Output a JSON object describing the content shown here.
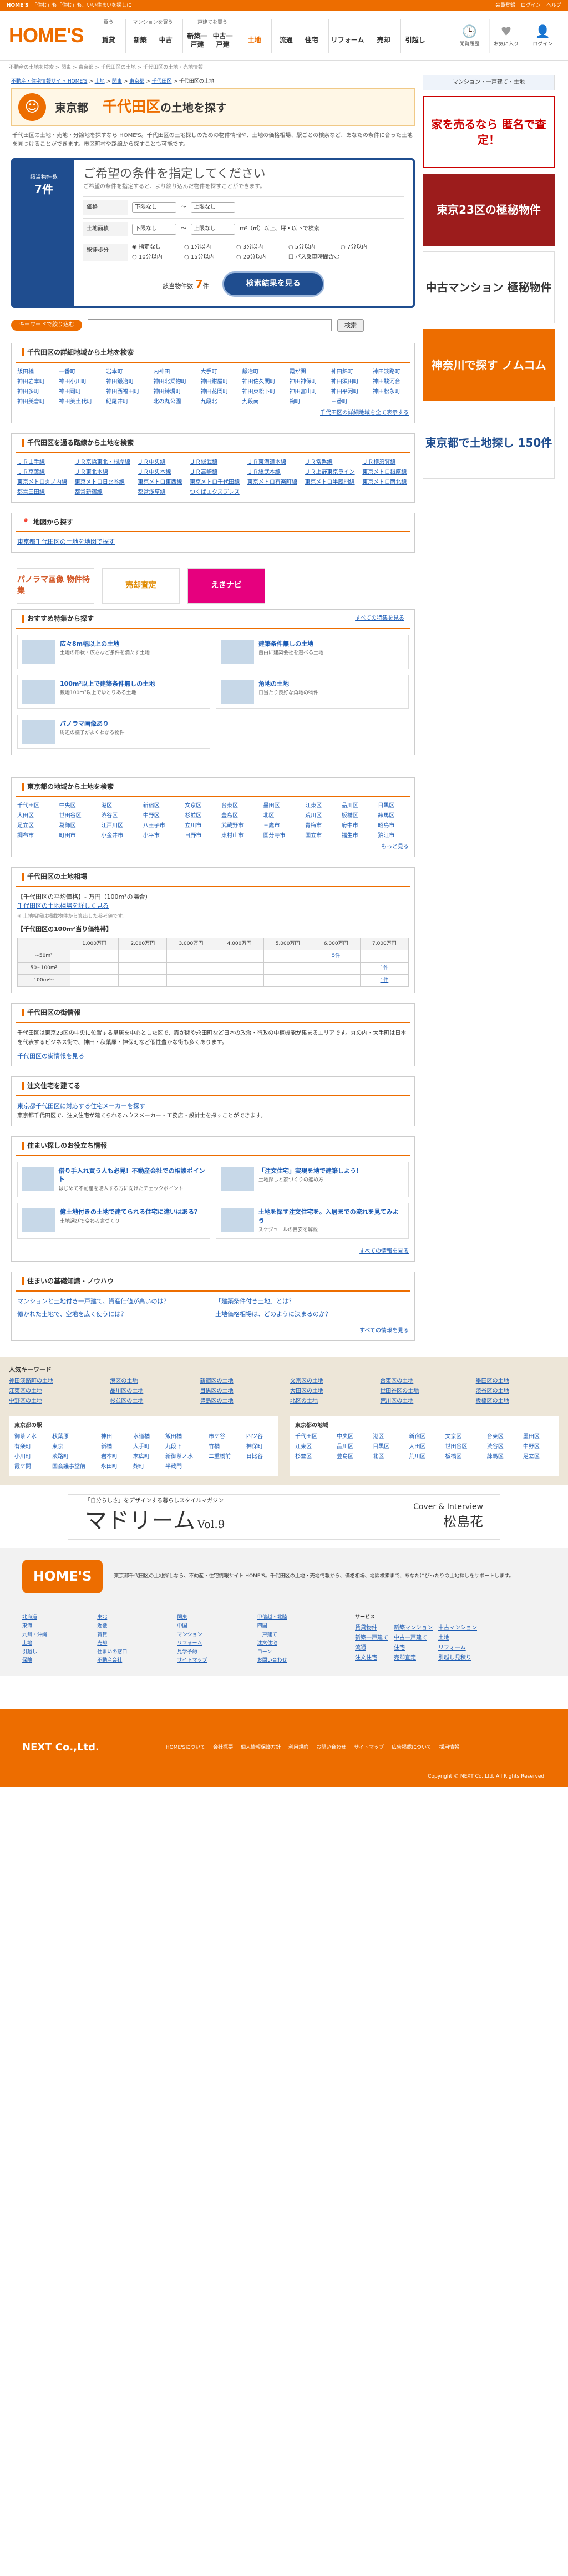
{
  "topbar": {
    "brand": "HOME'S",
    "tagline": "「住む」も「住む」も、いい住まいを探しに",
    "links": [
      "会員登録",
      "ログイン",
      "ヘルプ"
    ]
  },
  "header": {
    "logo": "HOME'S",
    "nav": [
      {
        "title": "買う",
        "items": [
          "賃貸"
        ]
      },
      {
        "title": "マンションを買う",
        "items": [
          "新築",
          "中古"
        ]
      },
      {
        "title": "一戸建てを買う",
        "items": [
          "新築一戸建",
          "中古一戸建"
        ]
      },
      {
        "title": "",
        "items": [
          "土地"
        ]
      },
      {
        "title": "",
        "items": [
          "流通",
          "住宅"
        ]
      },
      {
        "title": "",
        "items": [
          "リフォーム"
        ]
      },
      {
        "title": "",
        "items": [
          "売却"
        ]
      },
      {
        "title": "",
        "items": [
          "引越し"
        ]
      }
    ],
    "icons": [
      {
        "label": "閲覧履歴",
        "glyph": "🕒"
      },
      {
        "label": "お気に入り",
        "glyph": "♥"
      },
      {
        "label": "ログイン",
        "glyph": "👤"
      }
    ]
  },
  "crumb1": "不動産の土地を検索 > 関東 > 東京都 > 千代田区の土地 > 千代田区の土地・売地情報",
  "crumb2": [
    "不動産・住宅情報サイト HOME'S",
    "土地",
    "関東",
    "東京都",
    "千代田区",
    "千代田区の土地"
  ],
  "title": {
    "pref": "東京都",
    "city": "千代田区",
    "suffix": "の土地を探す"
  },
  "intro": "千代田区の土地・売地・分譲地を探すなら HOME'S。千代田区の土地探しのための物件情報や、土地の価格相場、駅ごとの検索など、あなたの条件に合った土地を見つけることができます。市区町村や路線から探すことも可能です。",
  "search": {
    "left_label": "該当物件数",
    "left_count": "7件",
    "heading": "ご希望の条件を指定してください",
    "sub": "ご希望の条件を指定すると、より絞り込んだ物件を探すことができます。",
    "price_label": "価格",
    "price_from": "下限なし",
    "price_to": "上限なし",
    "area_label": "土地面積",
    "area_from": "下限なし",
    "area_to": "上限なし",
    "area_note": "m²（㎡）以上、坪・以下で検索",
    "walk_label": "駅徒歩分",
    "walk_opts": [
      "指定なし",
      "1分以内",
      "3分以内",
      "5分以内",
      "7分以内",
      "10分以内",
      "15分以内",
      "20分以内",
      "バス乗車時間含む"
    ],
    "count_label": "該当物件数",
    "count": "7",
    "count_unit": "件",
    "button": "検索結果を見る"
  },
  "kw": {
    "label": "キーワードで絞り込む",
    "placeholder": "",
    "button": "検索"
  },
  "sec_area": {
    "title": "千代田区の詳細地域から土地を検索",
    "items": [
      "飯田橋",
      "一番町",
      "岩本町",
      "内神田",
      "大手町",
      "鍛冶町",
      "霞が関",
      "神田錦町",
      "神田淡路町",
      "神田岩本町",
      "神田小川町",
      "神田鍛冶町",
      "神田北乗物町",
      "神田紺屋町",
      "神田佐久間町",
      "神田神保町",
      "神田須田町",
      "神田駿河台",
      "神田多町",
      "神田司町",
      "神田西福田町",
      "神田練塀町",
      "神田花岡町",
      "神田東松下町",
      "神田富山町",
      "神田平河町",
      "神田松永町",
      "神田美倉町",
      "神田美土代町",
      "紀尾井町",
      "北の丸公園",
      "九段北",
      "九段南",
      "麹町",
      "三番町"
    ],
    "more": "千代田区の詳細地域を全て表示する"
  },
  "sec_line": {
    "title": "千代田区を通る路線から土地を検索",
    "items": [
      "ＪＲ山手線",
      "ＪＲ京浜東北・根岸線",
      "ＪＲ中央線",
      "ＪＲ総武線",
      "ＪＲ東海道本線",
      "ＪＲ常磐線",
      "ＪＲ横須賀線",
      "ＪＲ京葉線",
      "ＪＲ東北本線",
      "ＪＲ中央本線",
      "ＪＲ高崎線",
      "ＪＲ総武本線",
      "ＪＲ上野東京ライン",
      "東京メトロ銀座線",
      "東京メトロ丸ノ内線",
      "東京メトロ日比谷線",
      "東京メトロ東西線",
      "東京メトロ千代田線",
      "東京メトロ有楽町線",
      "東京メトロ半蔵門線",
      "東京メトロ南北線",
      "都営三田線",
      "都営新宿線",
      "都営浅草線",
      "つくばエクスプレス"
    ]
  },
  "sec_map": {
    "title": "地図から探す",
    "link": "東京都千代田区の土地を地図で探す"
  },
  "banners": [
    {
      "label": "パノラマ画像 物件特集",
      "color": "#d35a2a"
    },
    {
      "label": "売却査定",
      "color": "#e08a00"
    },
    {
      "label": "えきナビ",
      "color": "#e6007e"
    }
  ],
  "sec_feat": {
    "title": "おすすめ特集から探す",
    "more": "すべての特集を見る",
    "items": [
      {
        "title": "広々8m幅以上の土地",
        "desc": "土地の形状・広さなど条件を満たす土地"
      },
      {
        "title": "建築条件無しの土地",
        "desc": "自由に建築会社を選べる土地"
      },
      {
        "title": "100m²以上で建築条件無しの土地",
        "desc": "敷地100m²以上でゆとりある土地"
      },
      {
        "title": "角地の土地",
        "desc": "日当たり良好な角地の物件"
      },
      {
        "title": "パノラマ画像あり",
        "desc": "周辺の様子がよくわかる物件"
      }
    ]
  },
  "sec_city": {
    "title": "東京都の地域から土地を検索",
    "items": [
      "千代田区",
      "中央区",
      "港区",
      "新宿区",
      "文京区",
      "台東区",
      "墨田区",
      "江東区",
      "品川区",
      "目黒区",
      "大田区",
      "世田谷区",
      "渋谷区",
      "中野区",
      "杉並区",
      "豊島区",
      "北区",
      "荒川区",
      "板橋区",
      "練馬区",
      "足立区",
      "葛飾区",
      "江戸川区",
      "八王子市",
      "立川市",
      "武蔵野市",
      "三鷹市",
      "青梅市",
      "府中市",
      "昭島市",
      "調布市",
      "町田市",
      "小金井市",
      "小平市",
      "日野市",
      "東村山市",
      "国分寺市",
      "国立市",
      "福生市",
      "狛江市"
    ],
    "more": "もっと見る"
  },
  "sec_price": {
    "title": "千代田区の土地相場",
    "avg_label": "【千代田区の平均価格】",
    "avg": "- 万円（100m²の場合）",
    "link": "千代田区の土地相場を詳しく見る",
    "note": "※ 土地相場は掲載物件から算出した参考値です。",
    "table_title": "【千代田区の100m²当り価格帯】",
    "cols": [
      "",
      "1,000万円",
      "2,000万円",
      "3,000万円",
      "4,000万円",
      "5,000万円",
      "6,000万円",
      "7,000万円"
    ],
    "rows": [
      [
        "~50m²",
        "",
        "",
        "",
        "",
        "",
        "5件",
        ""
      ],
      [
        "50~100m²",
        "",
        "",
        "",
        "",
        "",
        "",
        "1件"
      ],
      [
        "100m²~",
        "",
        "",
        "",
        "",
        "",
        "",
        "1件"
      ]
    ]
  },
  "sec_town": {
    "title": "千代田区の街情報",
    "text": "千代田区は東京23区の中央に位置する皇居を中心とした区で、霞が関や永田町など日本の政治・行政の中枢機能が集まるエリアです。丸の内・大手町は日本を代表するビジネス街で、神田・秋葉原・神保町など個性豊かな街も多くあります。",
    "link": "千代田区の街情報を見る"
  },
  "sec_builder": {
    "title": "注文住宅を建てる",
    "link": "東京都千代田区に対応する住宅メーカーを探す",
    "text": "東京都千代田区で、注文住宅が建てられるハウスメーカー・工務店・設計士を探すことができます。"
  },
  "sec_tips": {
    "title": "住まい探しのお役立ち情報",
    "more": "すべての情報を見る",
    "items": [
      {
        "title": "借り手入れ買う人も必見！不動産会社での相談ポイント",
        "desc": "はじめて不動産を購入する方に向けたチェックポイント"
      },
      {
        "title": "「注文住宅」実現を地で建築しよう！",
        "desc": "土地探しと家づくりの進め方"
      },
      {
        "title": "億土地付きの土地で建てられる住宅に違いはある？",
        "desc": "土地選びで変わる家づくり"
      },
      {
        "title": "土地を探す注文住宅を。入居までの流れを見てみよう",
        "desc": "スケジュールの目安を解説"
      }
    ]
  },
  "sec_basic": {
    "title": "住まいの基礎知識・ノウハウ",
    "more": "すべての情報を見る",
    "items": [
      "マンションと土地付き一戸建て、資産価値が高いのは？",
      "「建築条件付き土地」とは？",
      "億かれた土地で、空地を広く使うには？",
      "土地価格相場は、どのように決まるのか？"
    ]
  },
  "zone": {
    "kw_title": "人気キーワード",
    "kw": [
      "神田淡路町の土地",
      "港区の土地",
      "新宿区の土地",
      "文京区の土地",
      "台東区の土地",
      "墨田区の土地",
      "江東区の土地",
      "品川区の土地",
      "目黒区の土地",
      "大田区の土地",
      "世田谷区の土地",
      "渋谷区の土地",
      "中野区の土地",
      "杉並区の土地",
      "豊島区の土地",
      "北区の土地",
      "荒川区の土地",
      "板橋区の土地"
    ],
    "st_title": "東京都の駅",
    "stations": [
      "御茶ノ水",
      "秋葉原",
      "神田",
      "水道橋",
      "飯田橋",
      "市ケ谷",
      "四ツ谷",
      "有楽町",
      "東京",
      "新橋",
      "大手町",
      "九段下",
      "竹橋",
      "神保町",
      "小川町",
      "淡路町",
      "岩本町",
      "末広町",
      "新御茶ノ水",
      "二重橋前",
      "日比谷",
      "霞ケ関",
      "国会議事堂前",
      "永田町",
      "麹町",
      "半蔵門"
    ],
    "ar_title": "東京都の地域",
    "areas": [
      "千代田区",
      "中央区",
      "港区",
      "新宿区",
      "文京区",
      "台東区",
      "墨田区",
      "江東区",
      "品川区",
      "目黒区",
      "大田区",
      "世田谷区",
      "渋谷区",
      "中野区",
      "杉並区",
      "豊島区",
      "北区",
      "荒川区",
      "板橋区",
      "練馬区",
      "足立区"
    ]
  },
  "mag": {
    "copy": "「自分らしさ」をデザインする暮らしスタイルマガジン",
    "name": "マドリーム",
    "vol": "Vol.9",
    "cover": "Cover & Interview",
    "person": "松島花"
  },
  "footer": {
    "logo": "HOME'S",
    "about": "東京都千代田区の土地探しなら、不動産・住宅情報サイト HOME'S。千代田区の土地・売地情報から、価格相場、地図検索まで、あなたにぴったりの土地探しをサポートします。",
    "links": [
      "北海道",
      "東北",
      "関東",
      "甲信越・北陸",
      "東海",
      "近畿",
      "中国",
      "四国",
      "九州・沖縄",
      "賃貸",
      "マンション",
      "一戸建て",
      "土地",
      "売却",
      "リフォーム",
      "注文住宅",
      "引越し",
      "住まいの窓口",
      "見学予約",
      "ローン",
      "保険",
      "不動産会社",
      "サイトマップ",
      "お問い合わせ"
    ],
    "svc_title": "サービス",
    "svc": [
      "賃貸物件",
      "新築マンション",
      "中古マンション",
      "新築一戸建て",
      "中古一戸建て",
      "土地",
      "流通",
      "住宅",
      "リフォーム",
      "注文住宅",
      "売却査定",
      "引越し見積り"
    ]
  },
  "company": {
    "name": "NEXT Co.,Ltd.",
    "links": [
      "HOME'Sについて",
      "会社概要",
      "個人情報保護方針",
      "利用規約",
      "お問い合わせ",
      "サイトマップ",
      "広告掲載について",
      "採用情報"
    ],
    "copy": "Copyright © NEXT Co.,Ltd. All Rights Reserved."
  },
  "side": {
    "ad1": "家を売るなら 匿名で査定！",
    "ad2": "東京23区の極秘物件",
    "ad3": "中古マンション 極秘物件",
    "ad4": "神奈川で探す ノムコム",
    "ad5": "東京都で土地探し 150件"
  }
}
